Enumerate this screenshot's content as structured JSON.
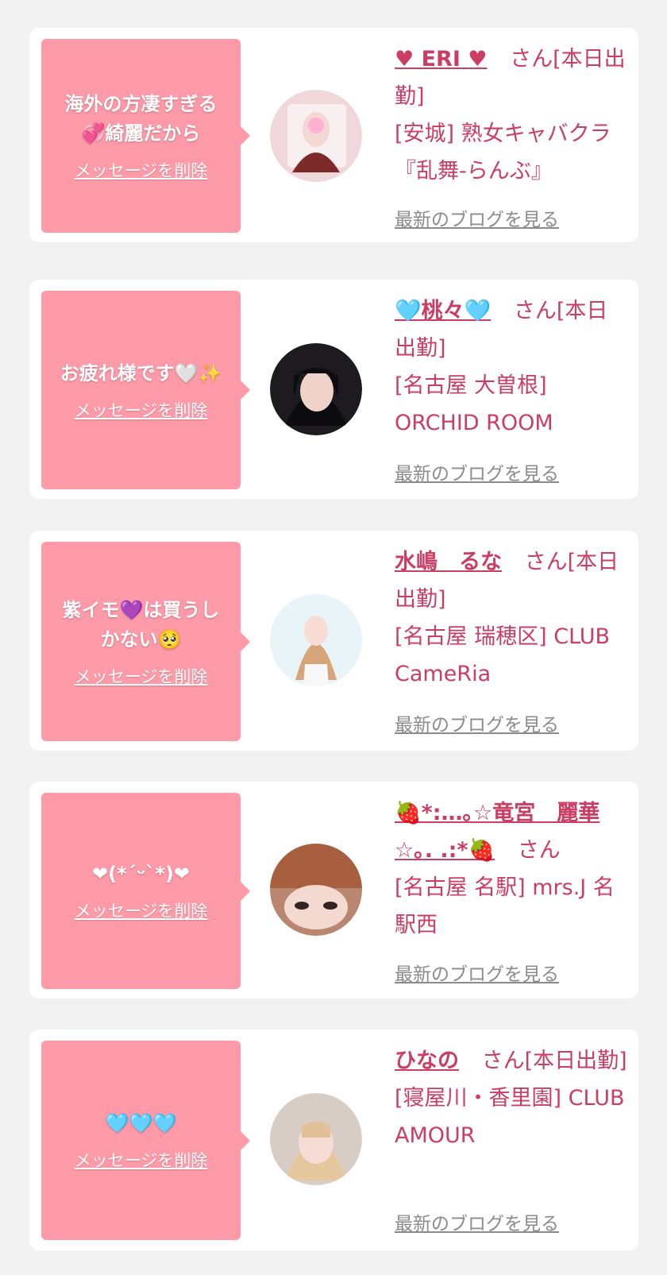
{
  "messages": [
    {
      "message": "海外の方凄すぎる\n💞綺麗だから",
      "delete_label": "メッセージを削除",
      "name": "♥ ERI ♥",
      "suffix": "さん[本日出勤]",
      "shop": "[安城] 熟女キャバクラ『乱舞-らんぶ』",
      "blog_label": "最新のブログを見る"
    },
    {
      "message": "お疲れ様です🤍✨",
      "delete_label": "メッセージを削除",
      "name": "🩵桃々🩵",
      "suffix": "さん[本日出勤]",
      "shop": "[名古屋 大曽根] ORCHID ROOM",
      "blog_label": "最新のブログを見る"
    },
    {
      "message": "紫イモ💜は買うし\nかない🥺",
      "delete_label": "メッセージを削除",
      "name": "水嶋　るな",
      "suffix": "さん[本日出勤]",
      "shop": "[名古屋 瑞穂区] CLUB CameRia",
      "blog_label": "最新のブログを見る"
    },
    {
      "message": "❤(*´ᵕ`*)❤",
      "delete_label": "メッセージを削除",
      "name": "🍓*:…｡☆竜宮　麗華☆｡. .:*🍓",
      "suffix": "さん",
      "shop": "[名古屋 名駅] mrs.J 名駅西",
      "blog_label": "最新のブログを見る"
    },
    {
      "message": "🩵🩵🩵",
      "delete_label": "メッセージを削除",
      "name": "ひなの",
      "suffix": "さん[本日出勤]",
      "shop": "[寝屋川・香里園] CLUB AMOUR",
      "blog_label": "最新のブログを見る"
    }
  ],
  "colors": {
    "background": "#f2f2f2",
    "card": "#ffffff",
    "bubble": "#ff9aa9",
    "accent": "#cc3d64",
    "muted": "#8b8b8b"
  },
  "icons": {
    "avatar": "profile-photo",
    "bubble_pointer": "triangle-right"
  }
}
